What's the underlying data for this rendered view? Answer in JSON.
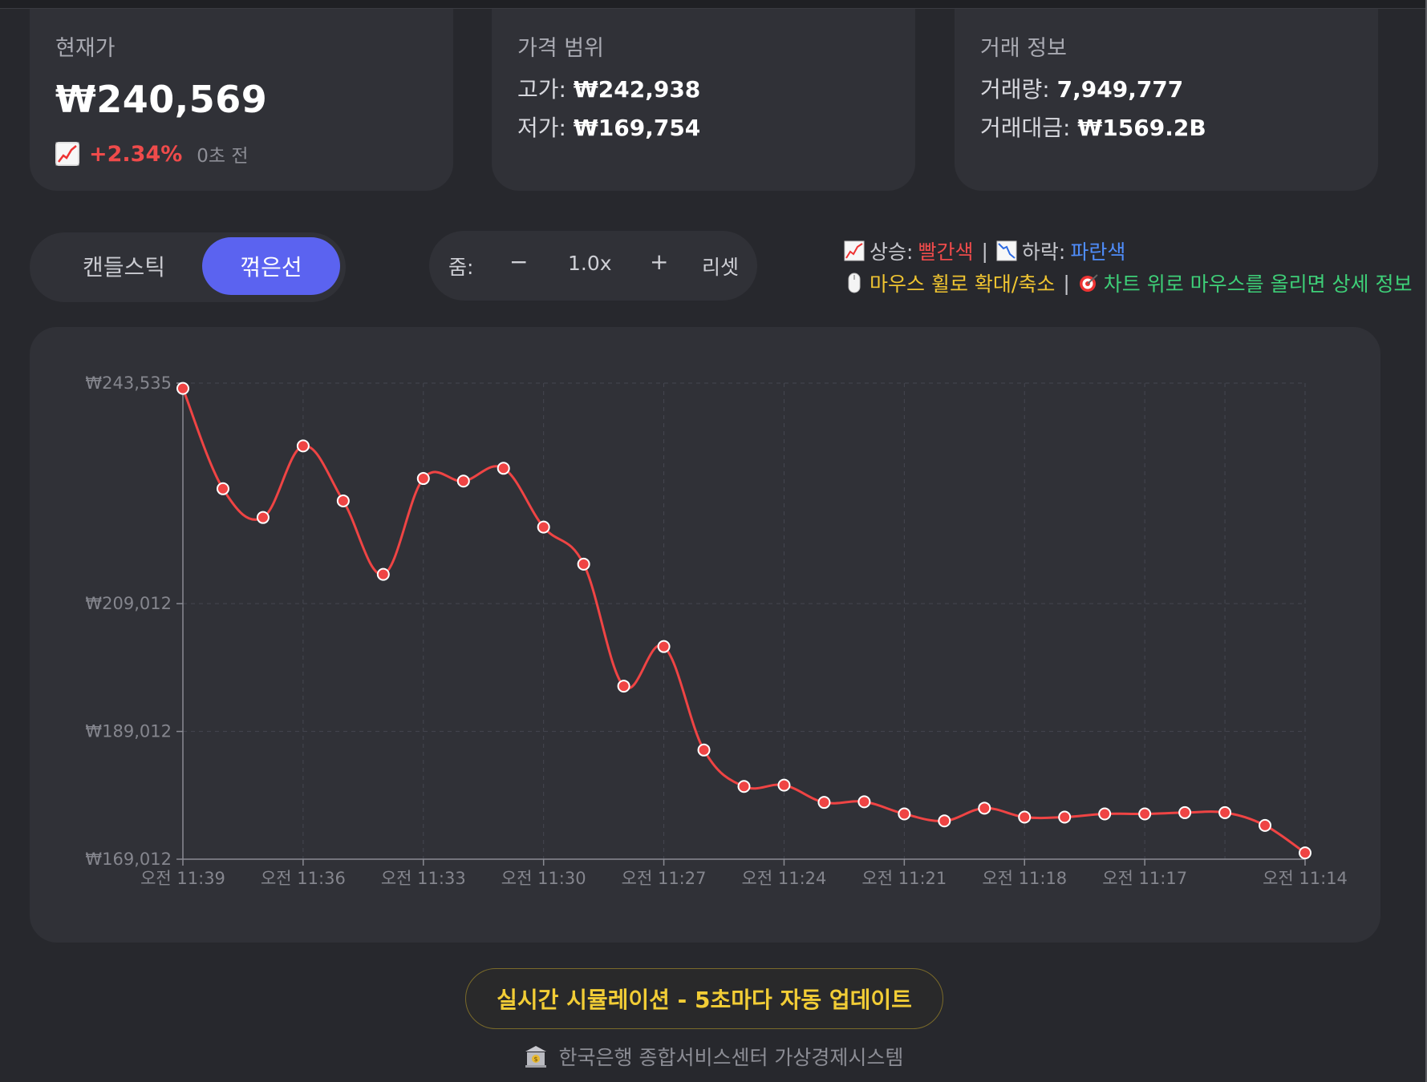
{
  "cards": {
    "current": {
      "label": "현재가",
      "price": "₩240,569",
      "change": "+2.34%",
      "ago": "0초 전",
      "icon": "chart-increasing-icon"
    },
    "range": {
      "label": "가격 범위",
      "high_key": "고가:",
      "high_val": "₩242,938",
      "low_key": "저가:",
      "low_val": "₩169,754"
    },
    "trade": {
      "label": "거래 정보",
      "volume_key": "거래량:",
      "volume_val": "7,949,777",
      "amount_key": "거래대금:",
      "amount_val": "₩1569.2B"
    }
  },
  "chart_type_toggle": {
    "candlestick": "캔들스틱",
    "line": "꺾은선",
    "selected": "꺾은선"
  },
  "zoom": {
    "label": "줌:",
    "minus": "−",
    "level": "1.0x",
    "plus": "+",
    "reset": "리셋"
  },
  "legend": {
    "up_label": "상승:",
    "up_color_name": "빨간색",
    "down_label": "하락:",
    "down_color_name": "파란색",
    "wheel_hint": "마우스 휠로 확대/축소",
    "hover_hint": "차트 위로 마우스를 올리면 상세 정보",
    "separator": "|"
  },
  "colors": {
    "up": "#ef4b4b",
    "down": "#4f8dfb",
    "accent": "#5b63f0",
    "line": "#ef4444",
    "sim_text": "#f2cd36"
  },
  "chart_data": {
    "type": "line",
    "ylim": [
      169012,
      243535
    ],
    "y_ticks": [
      "₩243,535",
      "₩209,012",
      "₩189,012",
      "₩169,012"
    ],
    "y_tick_values": [
      243535,
      209012,
      189012,
      169012
    ],
    "x_tick_labels": [
      "오전 11:39",
      "오전 11:36",
      "오전 11:33",
      "오전 11:30",
      "오전 11:27",
      "오전 11:24",
      "오전 11:21",
      "오전 11:18",
      "오전 11:17",
      "오전 11:14"
    ],
    "x_tick_indices": [
      0,
      3,
      6,
      9,
      12,
      15,
      18,
      21,
      24,
      28
    ],
    "grid": true,
    "values": [
      242700,
      227000,
      222500,
      233700,
      225100,
      213600,
      228600,
      228200,
      230200,
      221000,
      215200,
      196100,
      202300,
      186100,
      180400,
      180600,
      177900,
      178000,
      176100,
      175000,
      177000,
      175600,
      175600,
      176100,
      176100,
      176300,
      176300,
      174300,
      170000
    ]
  },
  "simulation_button": "실시간 시뮬레이션 - 5초마다 자동 업데이트",
  "footer": "한국은행 종합서비스센터 가상경제시스템"
}
